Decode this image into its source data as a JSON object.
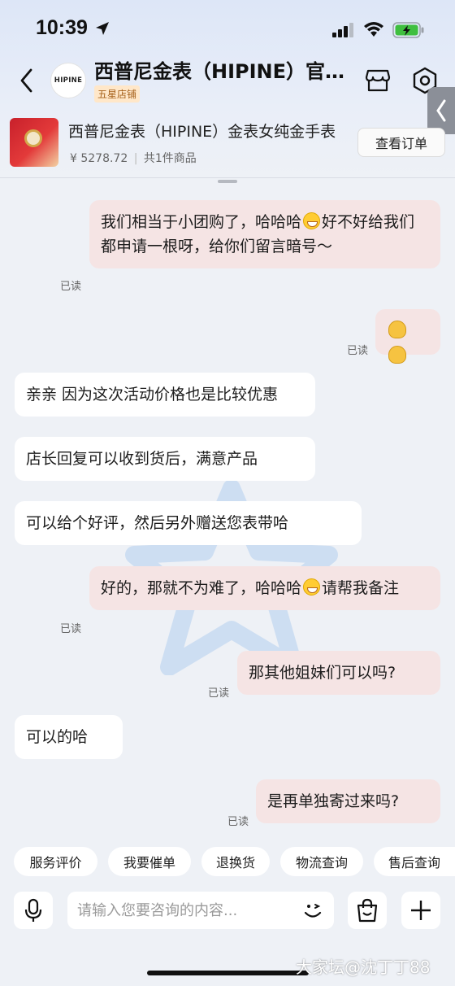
{
  "status_bar": {
    "time": "10:39"
  },
  "header": {
    "shop_logo_text": "HIPINE",
    "shop_name": "西普尼金表（HIPINE）官方旗舰店",
    "shop_badge": "五星店铺"
  },
  "order_card": {
    "product_name": "西普尼金表（HIPINE）金表女纯金手表",
    "price": "¥ 5278.72",
    "count": "共1件商品",
    "view_order_label": "查看订单"
  },
  "messages": [
    {
      "side": "right",
      "text_parts": [
        "我们相当于小团购了，哈哈哈",
        "好不好给我们都申请一根呀，给你们留言暗号～"
      ],
      "read": "已读"
    },
    {
      "side": "right",
      "read": "已读"
    },
    {
      "side": "left",
      "text": "亲亲 因为这次活动价格也是比较优惠"
    },
    {
      "side": "left",
      "text": "店长回复可以收到货后，满意产品"
    },
    {
      "side": "left",
      "text": "可以给个好评，然后另外赠送您表带哈"
    },
    {
      "side": "right",
      "text_parts": [
        "好的，那就不为难了，哈哈哈",
        "请帮我备注"
      ],
      "read": "已读"
    },
    {
      "side": "right",
      "text": "那其他姐妹们可以吗?",
      "read": "已读"
    },
    {
      "side": "left",
      "text": "可以的哈"
    },
    {
      "side": "right",
      "text": "是再单独寄过来吗?",
      "read": "已读"
    }
  ],
  "quick_actions": [
    "服务评价",
    "我要催单",
    "退换货",
    "物流查询",
    "售后查询"
  ],
  "input": {
    "placeholder": "请输入您要咨询的内容..."
  },
  "watermark_text": "大家坛@沈丁丁88",
  "colors": {
    "bubble_right": "#f5e4e4",
    "bubble_left": "#ffffff",
    "background": "#eef1f6",
    "badge_bg": "#ffe7c9"
  }
}
